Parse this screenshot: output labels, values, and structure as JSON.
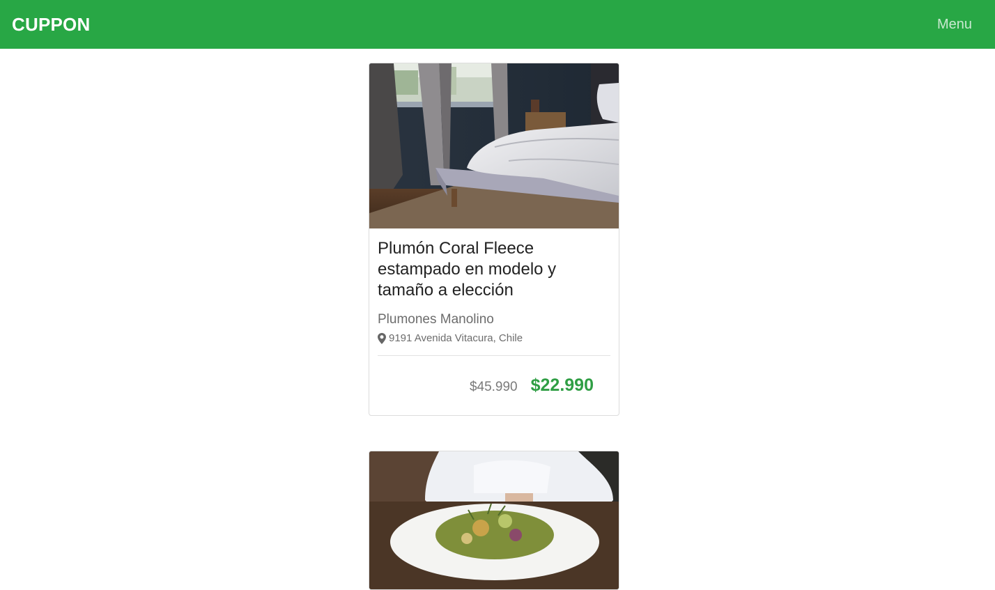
{
  "nav": {
    "brand": "CUPPON",
    "menu_label": "Menu",
    "color": "#28a745"
  },
  "deals": [
    {
      "image": "bedroom-bed-photo",
      "title": "Plumón Coral Fleece estampado en modelo y tamaño a elección",
      "merchant": "Plumones Manolino",
      "location_icon": "map-pin-icon",
      "location": "9191 Avenida Vitacura, Chile",
      "old_price": "$45.990",
      "new_price": "$22.990"
    },
    {
      "image": "salad-plate-photo"
    }
  ],
  "colors": {
    "price_accent": "#2f9e44"
  }
}
